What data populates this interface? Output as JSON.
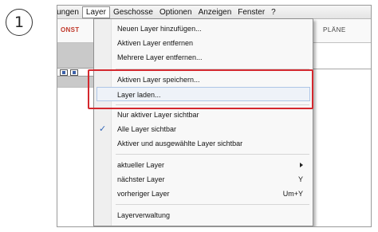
{
  "step_number": "1",
  "menubar": {
    "items": [
      "rtungen",
      "Layer",
      "Geschosse",
      "Optionen",
      "Anzeigen",
      "Fenster",
      "?"
    ]
  },
  "ribbon": {
    "left_label": "ONST",
    "right_label": "PLÄNE"
  },
  "layer_menu": {
    "items": [
      {
        "label": "Neuen Layer hinzufügen...",
        "shortcut": ""
      },
      {
        "label": "Aktiven Layer entfernen",
        "shortcut": ""
      },
      {
        "label": "Mehrere Layer entfernen...",
        "shortcut": ""
      },
      {
        "label": "Aktiven Layer speichern...",
        "shortcut": ""
      },
      {
        "label": "Layer laden...",
        "shortcut": ""
      },
      {
        "label": "Nur aktiver Layer sichtbar",
        "shortcut": ""
      },
      {
        "label": "Alle Layer sichtbar",
        "shortcut": "",
        "checked": true
      },
      {
        "label": "Aktiver und ausgewählte Layer sichtbar",
        "shortcut": ""
      },
      {
        "label": "aktueller Layer",
        "shortcut": "",
        "submenu": true
      },
      {
        "label": "nächster Layer",
        "shortcut": "Y"
      },
      {
        "label": "vorheriger Layer",
        "shortcut": "Um+Y"
      },
      {
        "label": "Layerverwaltung",
        "shortcut": ""
      }
    ],
    "highlighted_item": "Layer laden...",
    "callout_color": "#d4282e"
  }
}
